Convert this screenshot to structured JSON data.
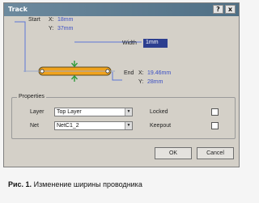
{
  "window": {
    "title": "Track",
    "help_label": "?",
    "close_label": "x"
  },
  "start": {
    "label": "Start",
    "x_label": "X:",
    "x_value": "18mm",
    "y_label": "Y:",
    "y_value": "37mm"
  },
  "width": {
    "label": "Width",
    "value": "1mm"
  },
  "end": {
    "label": "End",
    "x_label": "X:",
    "x_value": "19.46mm",
    "y_label": "Y:",
    "y_value": "28mm"
  },
  "properties": {
    "title": "Properties",
    "layer_label": "Layer",
    "layer_value": "Top Layer",
    "net_label": "Net",
    "net_value": "NetC1_2",
    "locked_label": "Locked",
    "keepout_label": "Keepout"
  },
  "buttons": {
    "ok": "OK",
    "cancel": "Cancel"
  },
  "caption": {
    "prefix": "Рис. 1.",
    "text": "Изменение ширины проводника"
  },
  "colors": {
    "track": "#f0a21c",
    "track_outline": "#5a4a20",
    "guide": "#5b76d6",
    "arrow": "#2f9b3a"
  }
}
